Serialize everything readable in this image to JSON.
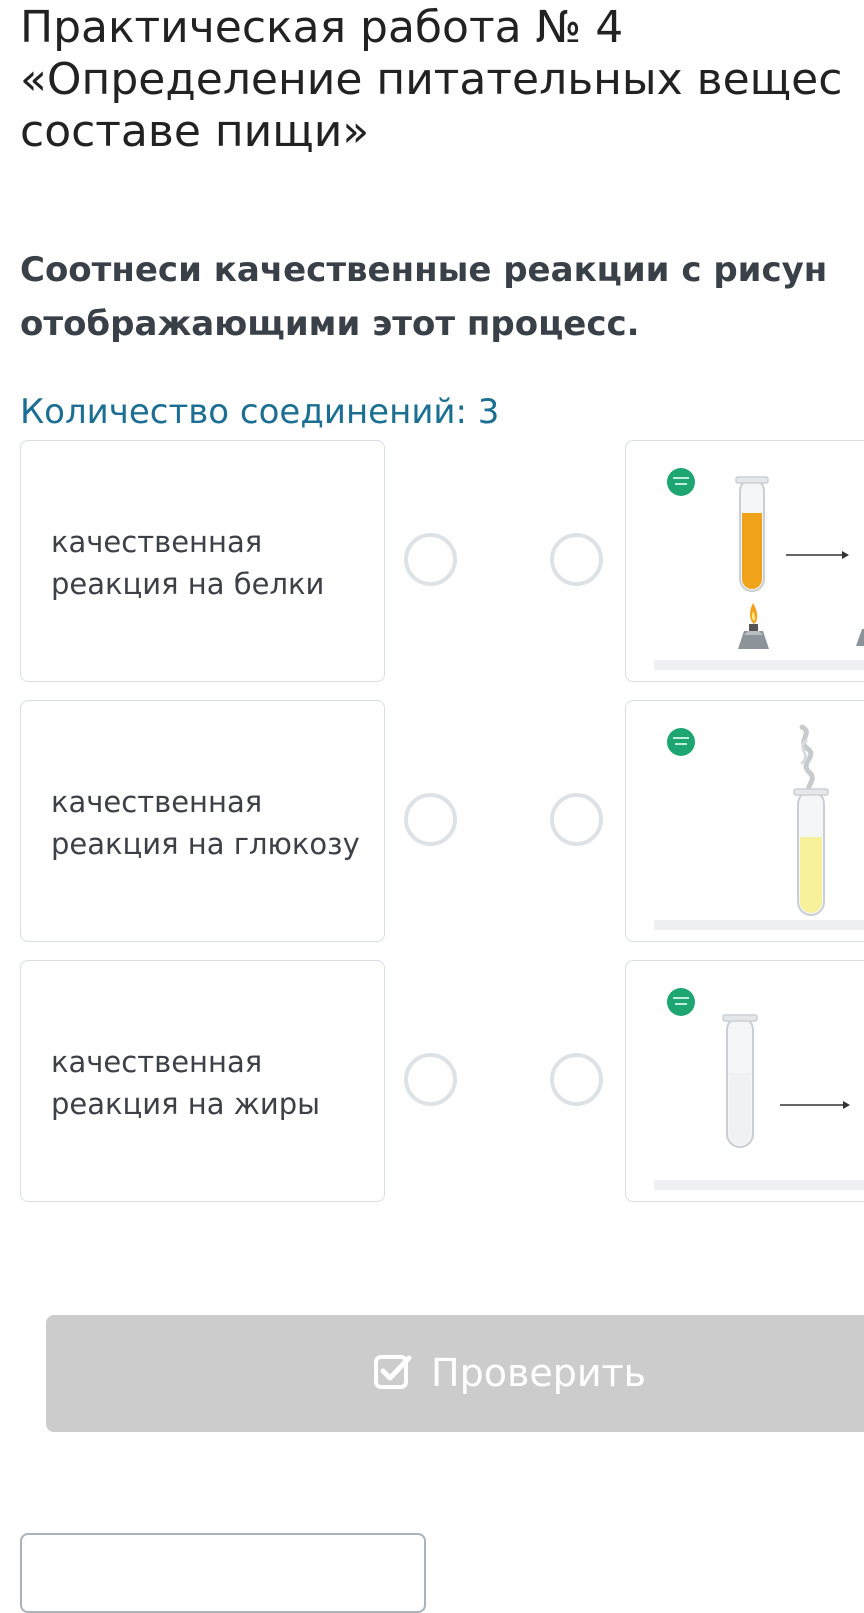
{
  "page": {
    "title_lines": [
      "Практическая работа № 4",
      "«Определение питательных вещес",
      "составе пищи»"
    ],
    "instruction_lines": [
      "Соотнеси качественные реакции с рисун",
      "отображающими этот процесс."
    ],
    "connections_count": "Количество соединений: 3"
  },
  "left_items": [
    {
      "label": "качественная реакция на белки"
    },
    {
      "label": "качественная реакция на глюкозу"
    },
    {
      "label": "качественная реакция на жиры"
    }
  ],
  "right_items": [
    {
      "image": "orange-test-tube-over-spirit-lamp-with-arrow"
    },
    {
      "image": "yellow-test-tube-with-smoke"
    },
    {
      "image": "empty-test-tube-with-arrow"
    }
  ],
  "check_button": {
    "label": "Проверить",
    "icon": "checkbox-icon"
  },
  "colors": {
    "count_text": "#1c6f93",
    "card_border": "#d9dee3",
    "connector_ring": "#dde2e6",
    "button_bg": "#cccccc",
    "badge_green": "#1ea672"
  }
}
